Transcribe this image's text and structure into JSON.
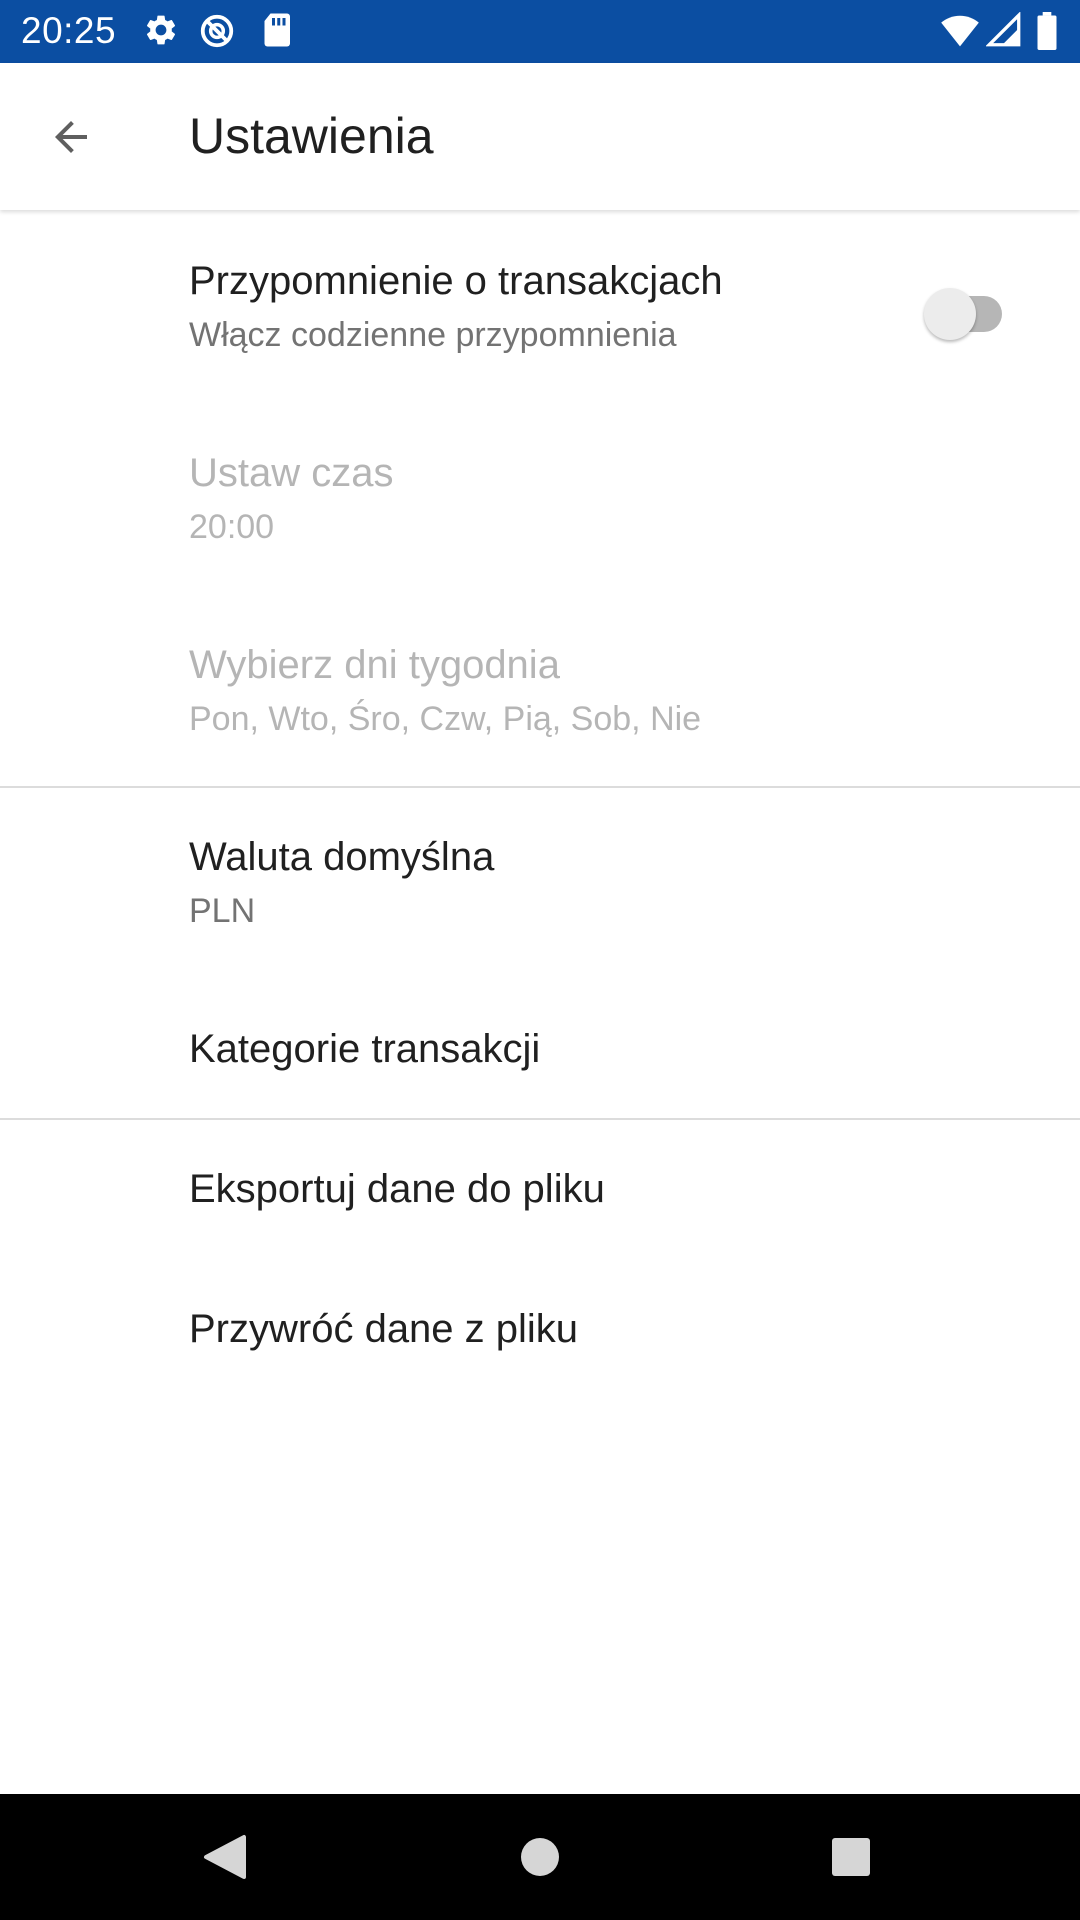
{
  "status_bar": {
    "time": "20:25",
    "background": "#0b4ea2",
    "left_icons": [
      "gear-icon",
      "do-not-disturb-icon",
      "sd-card-icon"
    ],
    "right_icons": [
      "wifi-icon",
      "cellular-signal-icon",
      "battery-icon"
    ]
  },
  "app_bar": {
    "title": "Ustawienia",
    "back_icon": "arrow-back-icon"
  },
  "preferences": {
    "reminder": {
      "title": "Przypomnienie o transakcjach",
      "summary": "Włącz codzienne przypomnienia",
      "enabled": false
    },
    "time": {
      "title": "Ustaw czas",
      "summary": "20:00"
    },
    "days": {
      "title": "Wybierz dni tygodnia",
      "summary": "Pon, Wto, Śro, Czw, Pią, Sob, Nie"
    },
    "currency": {
      "title": "Waluta domyślna",
      "summary": "PLN"
    },
    "categories": {
      "title": "Kategorie transakcji"
    },
    "export": {
      "title": "Eksportuj dane do pliku"
    },
    "restore": {
      "title": "Przywróć dane z pliku"
    }
  },
  "nav_bar": {
    "buttons": [
      "back-triangle-icon",
      "home-circle-icon",
      "recents-square-icon"
    ]
  }
}
